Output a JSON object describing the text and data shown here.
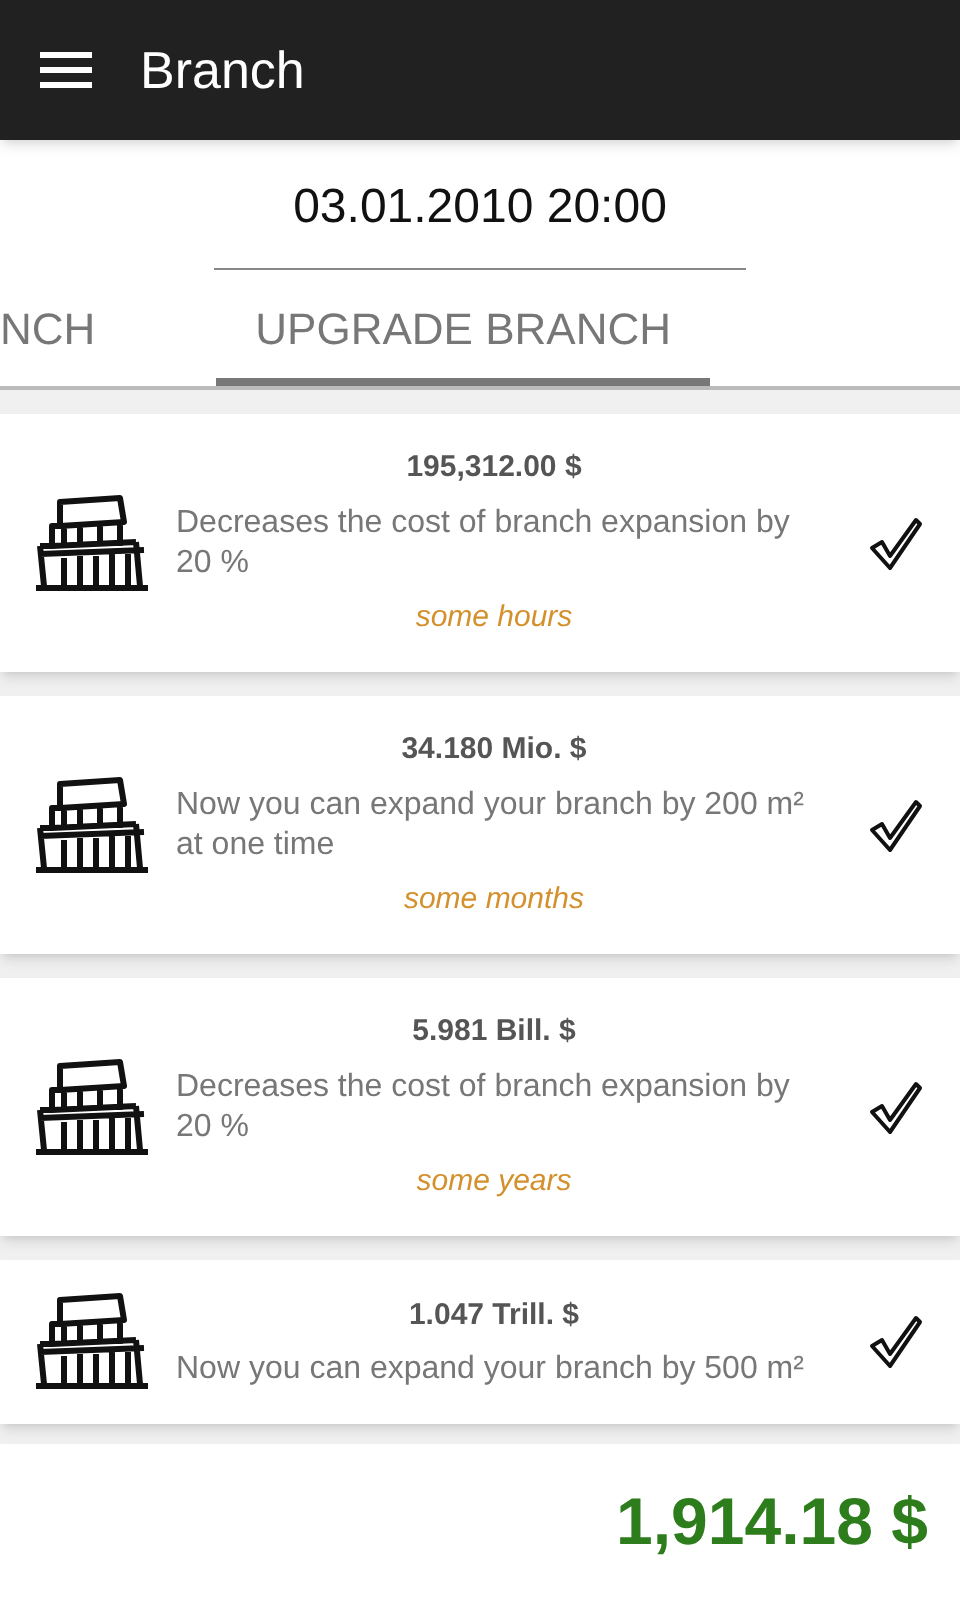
{
  "app_bar": {
    "title": "Branch"
  },
  "date_field": {
    "value": "03.01.2010 20:00"
  },
  "tabs": [
    {
      "label": "NCH",
      "selected": false
    },
    {
      "label": "UPGRADE BRANCH",
      "selected": true
    }
  ],
  "upgrades": [
    {
      "price": "195,312.00 $",
      "description": "Decreases the cost of branch expansion by 20 %",
      "duration": "some hours",
      "checked": true
    },
    {
      "price": "34.180 Mio. $",
      "description": "Now you can expand your branch by 200 m² at one time",
      "duration": "some months",
      "checked": true
    },
    {
      "price": "5.981 Bill. $",
      "description": "Decreases the cost of branch expansion by 20 %",
      "duration": "some years",
      "checked": true
    },
    {
      "price": "1.047 Trill. $",
      "description": "Now you can expand your branch by 500 m²",
      "checked": true
    }
  ],
  "balance": "1,914.18 $"
}
